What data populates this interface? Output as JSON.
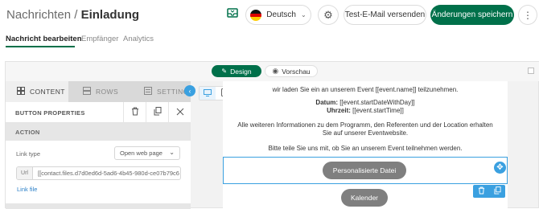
{
  "header": {
    "breadcrumb_parent": "Nachrichten",
    "breadcrumb_sep": " / ",
    "breadcrumb_current": "Einladung",
    "language": "Deutsch",
    "test_email_label": "Test-E-Mail versenden",
    "save_label": "Änderungen speichern"
  },
  "tabs": [
    {
      "label": "Nachricht bearbeiten",
      "active": true
    },
    {
      "label": "Empfänger",
      "active": false
    },
    {
      "label": "Analytics",
      "active": false
    }
  ],
  "editor": {
    "mode_design": "Design",
    "mode_preview": "Vorschau",
    "panel_tabs": [
      "CONTENT",
      "ROWS",
      "SETTINGS"
    ],
    "button_properties": "BUTTON PROPERTIES",
    "action_label": "ACTION",
    "link_type_label": "Link type",
    "link_type_value": "Open web page",
    "url_prefix": "Url",
    "url_value": "[[contact.files.d7d0ed6d-5ad6-4b45-980d-ce07b79c6",
    "link_file": "Link file"
  },
  "canvas": {
    "line1": "wir laden Sie ein an unserem Event [[event.name]] teilzunehmen.",
    "date_label": "Datum:",
    "date_value": " [[event.startDateWithDay]]",
    "time_label": "Uhrzeit:",
    "time_value": " [[event.startTime]]",
    "info_line1": "Alle weiteren Informationen zu dem Programm, den Referenten und der Location erhalten",
    "info_line2": "Sie auf unserer Eventwebsite.",
    "confirm_line": "Bitte teile Sie uns mit, ob Sie an unserem Event teilnehmen werden.",
    "button_personal": "Personalisierte Datei",
    "button_calendar": "Kalender"
  },
  "colors": {
    "brand_green": "#00704a",
    "accent_blue": "#3aa0e0",
    "button_gray": "#7f7f7f"
  }
}
